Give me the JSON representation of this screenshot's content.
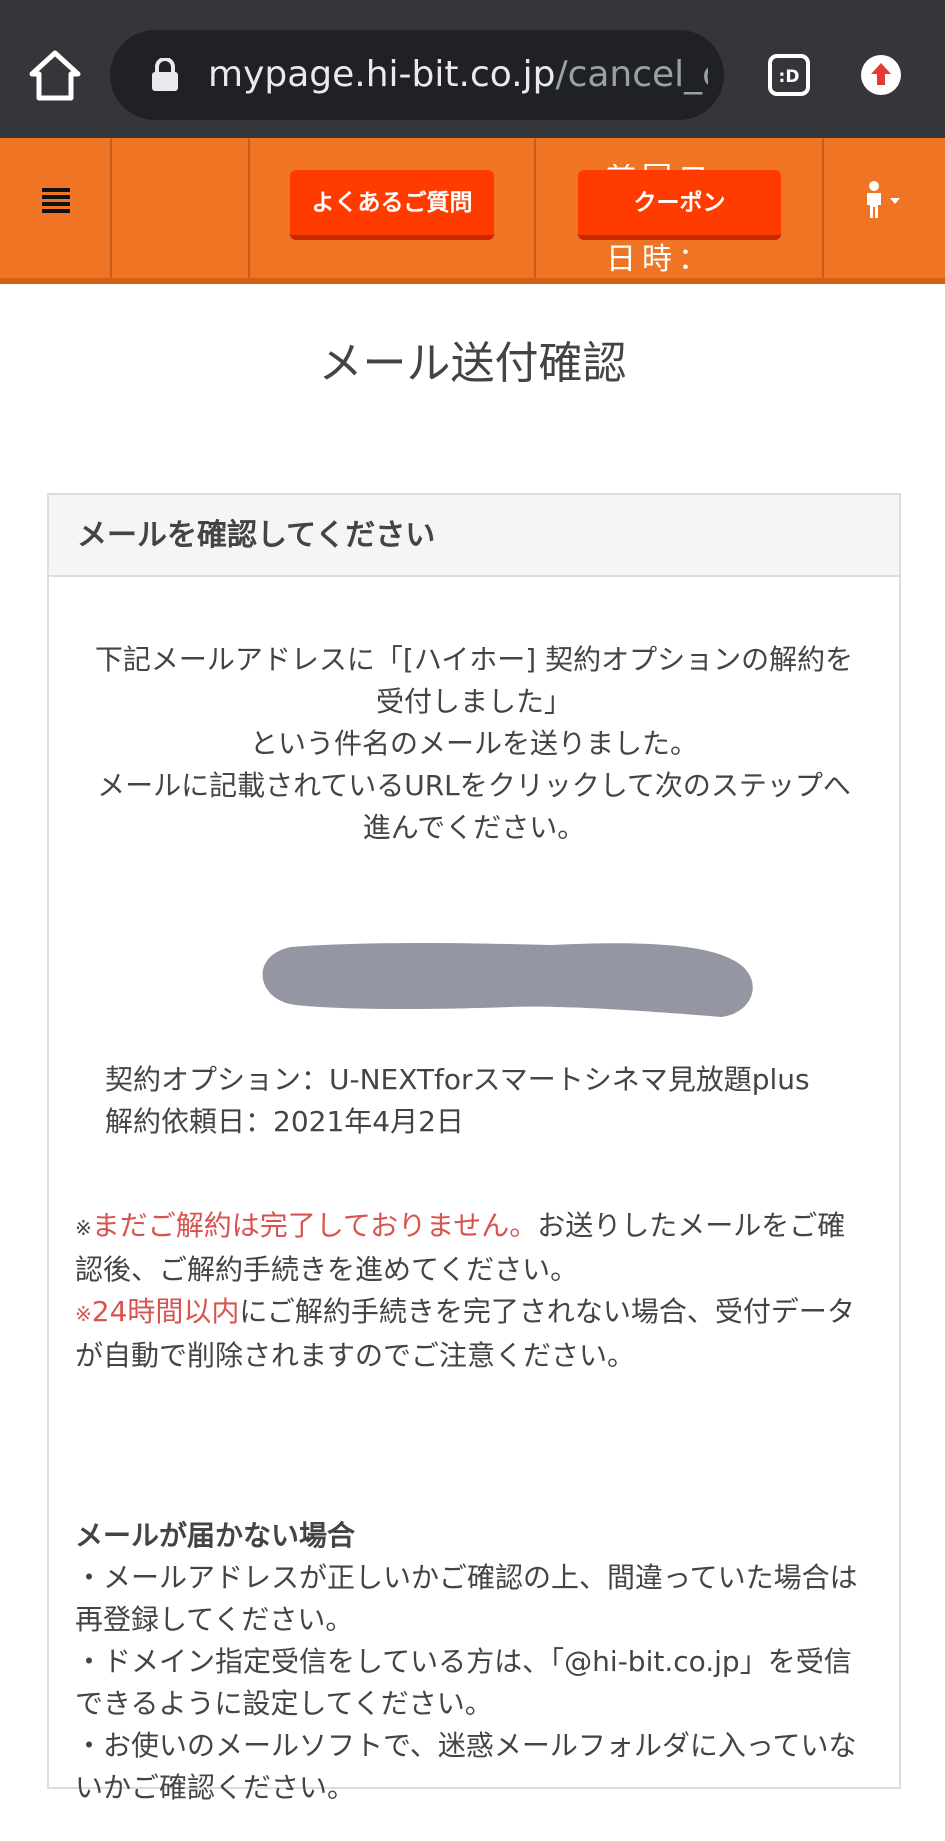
{
  "browser": {
    "url_domain": "mypage.hi-bit.co.jp",
    "url_path": "/cancel_con",
    "tab_icon_label": ":D"
  },
  "header": {
    "faq_button": "よくあるご質問",
    "coupon_button": "クーポン",
    "overflow_top": "前回ロ",
    "overflow_bottom": "日時："
  },
  "page": {
    "title": "メール送付確認"
  },
  "card": {
    "header": "メールを確認してください",
    "intro_lines": [
      "下記メールアドレスに「[ハイホー] 契約オプションの解約を",
      "受付しました」",
      "という件名のメールを送りました。",
      "メールに記載されているURLをクリックして次のステップへ",
      "進んでください。"
    ],
    "contract_option": "契約オプション：U-NEXTforスマートシネマ見放題plus",
    "request_date": "解約依頼日：2021年4月2日",
    "note1_mark": "※",
    "note1_red": "まだご解約は完了しておりません。",
    "note1_rest": "お送りしたメールをご確認後、ご解約手続きを進めてください。",
    "note2_mark": "※",
    "note2_red": "24時間以内",
    "note2_rest": "にご解約手続きを完了されない場合、受付データが自動で削除されますのでご注意ください。",
    "nomail_title": "メールが届かない場合",
    "nomail_items": [
      "・メールアドレスが正しいかご確認の上、間違っていた場合は再登録してください。",
      "・ドメイン指定受信をしている方は、「@hi-bit.co.jp」を受信できるように設定してください。",
      "・お使いのメールソフトで、迷惑メールフォルダに入っていないかご確認ください。"
    ]
  },
  "colors": {
    "header_orange": "#ef7424",
    "button_red": "#ff3b00",
    "warning_red": "#d9534f",
    "browser_dark": "#35363a"
  }
}
